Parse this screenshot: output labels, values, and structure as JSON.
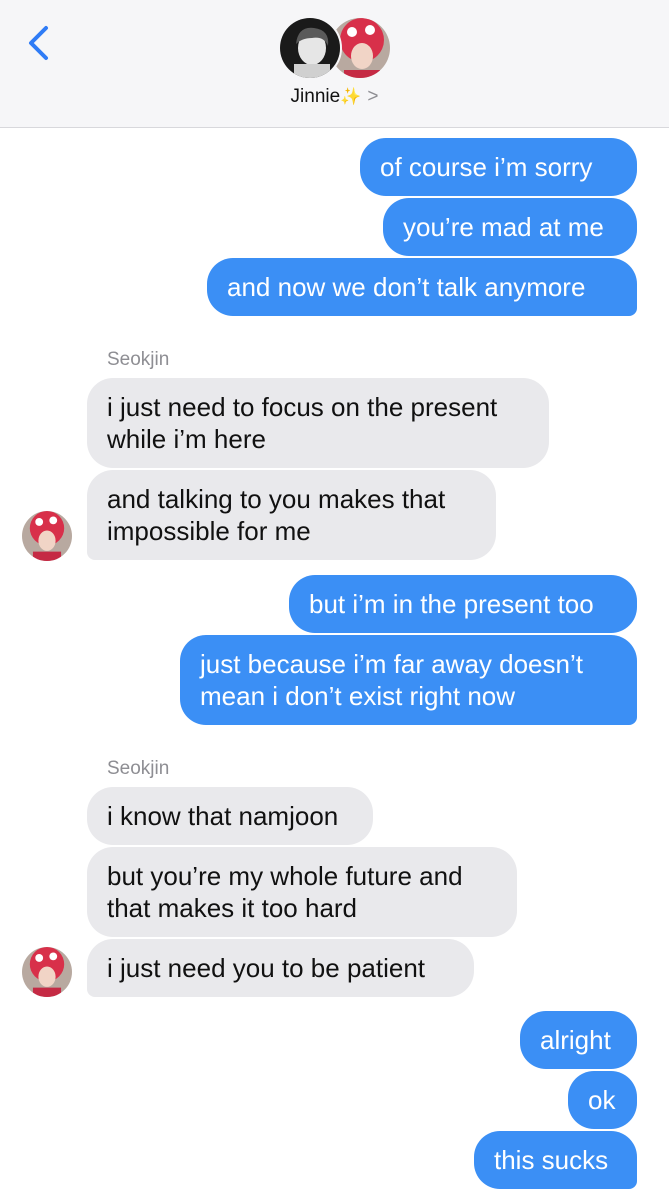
{
  "header": {
    "contact_name": "Jinnie",
    "contact_emoji": "✨",
    "chevron": ">"
  },
  "senders": {
    "group1": "Seokjin",
    "group2": "Seokjin"
  },
  "messages": [
    {
      "from": "me",
      "text": "of course i’m sorry"
    },
    {
      "from": "me",
      "text": "you’re mad at me"
    },
    {
      "from": "me",
      "text": "and now we don’t talk anymore"
    },
    {
      "from": "Seokjin",
      "lines": [
        "i just need to focus on the present",
        "while i’m here"
      ]
    },
    {
      "from": "Seokjin",
      "lines": [
        "and talking to you makes that",
        "impossible for me"
      ]
    },
    {
      "from": "me",
      "text": "but i’m in the present too"
    },
    {
      "from": "me",
      "lines": [
        "just because i’m far away doesn’t",
        "mean i don’t exist right now"
      ]
    },
    {
      "from": "Seokjin",
      "text": "i know that namjoon"
    },
    {
      "from": "Seokjin",
      "lines": [
        "but you’re my whole future and",
        "that makes it too hard"
      ]
    },
    {
      "from": "Seokjin",
      "text": "i just need you to be patient"
    },
    {
      "from": "me",
      "text": "alright"
    },
    {
      "from": "me",
      "text": "ok"
    },
    {
      "from": "me",
      "text": "this sucks"
    }
  ],
  "colors": {
    "outgoing_bubble": "#3b8ff5",
    "incoming_bubble": "#e9e9ec",
    "accent": "#2f7cf6"
  }
}
